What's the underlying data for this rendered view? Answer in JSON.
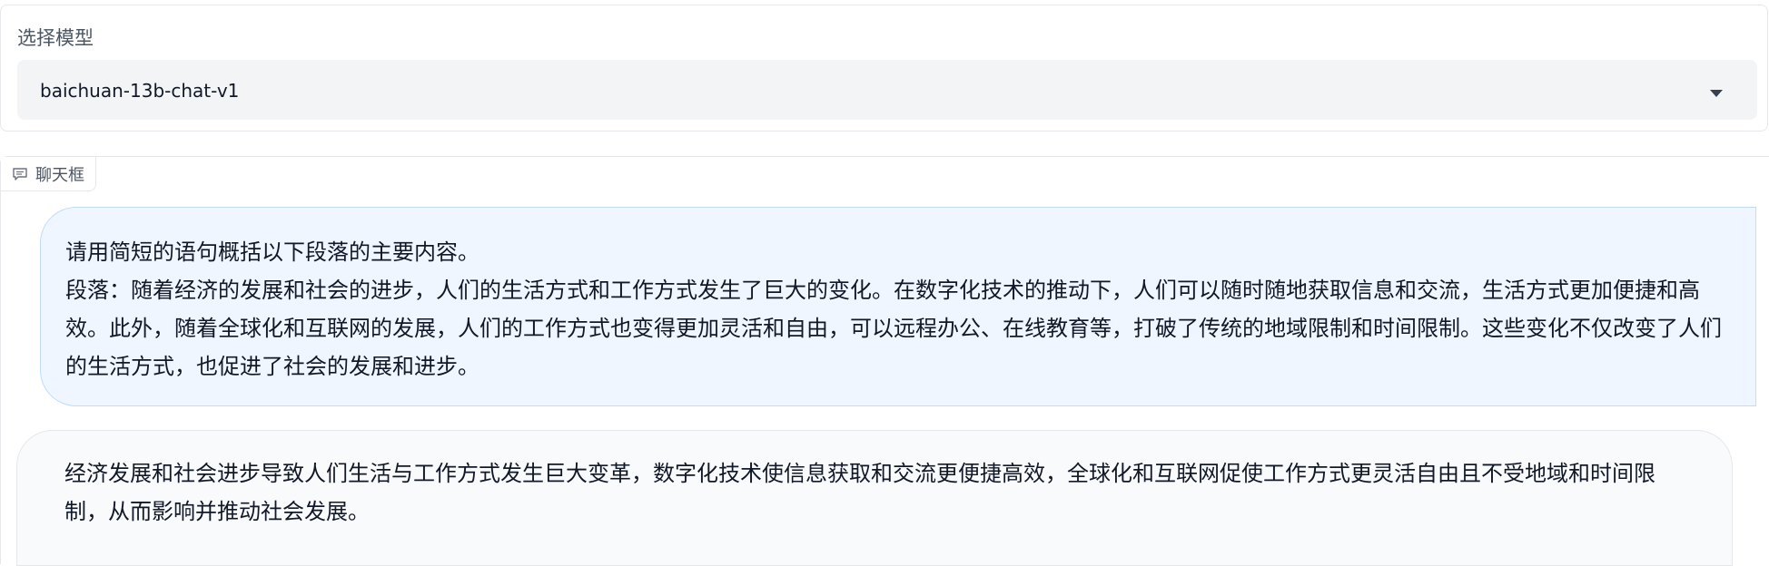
{
  "model": {
    "label": "选择模型",
    "selected": "baichuan-13b-chat-v1"
  },
  "chat": {
    "tab_label": "聊天框",
    "messages": [
      {
        "role": "user",
        "line1": "请用简短的语句概括以下段落的主要内容。",
        "line2": "段落：随着经济的发展和社会的进步，人们的生活方式和工作方式发生了巨大的变化。在数字化技术的推动下，人们可以随时随地获取信息和交流，生活方式更加便捷和高效。此外，随着全球化和互联网的发展，人们的工作方式也变得更加灵活和自由，可以远程办公、在线教育等，打破了传统的地域限制和时间限制。这些变化不仅改变了人们的生活方式，也促进了社会的发展和进步。"
      },
      {
        "role": "bot",
        "text": "经济发展和社会进步导致人们生活与工作方式发生巨大变革，数字化技术使信息获取和交流更便捷高效，全球化和互联网促使工作方式更灵活自由且不受地域和时间限制，从而影响并推动社会发展。"
      }
    ]
  },
  "icons": {
    "dropdown": "chevron-down-icon",
    "chat": "chat-bubble-icon"
  }
}
